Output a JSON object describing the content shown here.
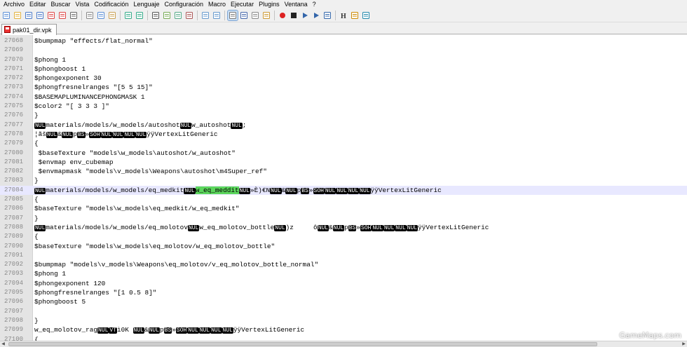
{
  "menu": [
    "Archivo",
    "Editar",
    "Buscar",
    "Vista",
    "Codificación",
    "Lenguaje",
    "Configuración",
    "Macro",
    "Ejecutar",
    "Plugins",
    "Ventana",
    "?"
  ],
  "toolbar_icons": [
    "new-file-icon",
    "open-file-icon",
    "save-icon",
    "save-all-icon",
    "close-icon",
    "close-all-icon",
    "print-icon",
    "cut-icon",
    "copy-icon",
    "paste-icon",
    "undo-icon",
    "redo-icon",
    "find-icon",
    "replace-icon",
    "zoom-in-icon",
    "zoom-out-icon",
    "sync-vertical-icon",
    "sync-horizontal-icon",
    "word-wrap-icon",
    "show-all-chars-icon",
    "indent-guide-icon",
    "doc-map-icon",
    "record-macro-icon",
    "stop-record-icon",
    "play-macro-icon",
    "run-macro-multiple-icon",
    "save-macro-icon",
    "function-list-icon",
    "spell-check-icon",
    "plugin-icon"
  ],
  "tab": {
    "label": "pak01_dir.vpk"
  },
  "lines": [
    {
      "n": "27068",
      "segs": [
        [
          "t",
          "$bumpmap \"effects/flat_normal\""
        ]
      ]
    },
    {
      "n": "27069",
      "segs": []
    },
    {
      "n": "27070",
      "segs": [
        [
          "t",
          "$phong 1"
        ]
      ]
    },
    {
      "n": "27071",
      "segs": [
        [
          "t",
          "$phongboost 1"
        ]
      ]
    },
    {
      "n": "27072",
      "segs": [
        [
          "t",
          "$phongexponent 30"
        ]
      ]
    },
    {
      "n": "27073",
      "segs": [
        [
          "t",
          "$phongfresnelranges \"[5 5 15]\""
        ]
      ]
    },
    {
      "n": "27074",
      "segs": [
        [
          "t",
          "$BASEMAPLUMINANCEPHONGMASK 1"
        ]
      ]
    },
    {
      "n": "27075",
      "segs": [
        [
          "t",
          "$color2 \"[ 3 3 3 ]\""
        ]
      ]
    },
    {
      "n": "27076",
      "segs": [
        [
          "t",
          "}"
        ]
      ]
    },
    {
      "n": "27077",
      "segs": [
        [
          "c",
          "NUL"
        ],
        [
          "t",
          "materials/models/w_models/autoshot"
        ],
        [
          "c",
          "NUL"
        ],
        [
          "t",
          "w_autoshot"
        ],
        [
          "c",
          "NUL"
        ],
        [
          "t",
          ";"
        ]
      ]
    },
    {
      "n": "27078",
      "segs": [
        [
          "t",
          "¦ãš"
        ],
        [
          "c",
          "NUL"
        ],
        [
          "t",
          "&"
        ],
        [
          "c",
          "NUL"
        ],
        [
          "t",
          "p"
        ],
        [
          "c",
          "BS"
        ],
        [
          "t",
          "»"
        ],
        [
          "c",
          "SOH"
        ],
        [
          "c",
          "NUL"
        ],
        [
          "c",
          "NUL"
        ],
        [
          "c",
          "NUL"
        ],
        [
          "c",
          "NUL"
        ],
        [
          "t",
          "ÿÿVertexLitGeneric"
        ]
      ]
    },
    {
      "n": "27079",
      "segs": [
        [
          "t",
          "{"
        ]
      ]
    },
    {
      "n": "27080",
      "segs": [
        [
          "t",
          " $baseTexture \"models\\w_models\\autoshot/w_autoshot\""
        ]
      ]
    },
    {
      "n": "27081",
      "segs": [
        [
          "t",
          " $envmap env_cubemap"
        ]
      ]
    },
    {
      "n": "27082",
      "segs": [
        [
          "t",
          " $envmapmask \"models\\v_models\\Weapons\\autoshot\\m4Super_ref\""
        ]
      ]
    },
    {
      "n": "27083",
      "segs": [
        [
          "t",
          "}"
        ]
      ]
    },
    {
      "n": "27084",
      "cur": true,
      "segs": [
        [
          "c",
          "NUL"
        ],
        [
          "t",
          "materials/models/w_models/eq_medkit"
        ],
        [
          "c",
          "NUL"
        ],
        [
          "s",
          "w_eq_meddit"
        ],
        [
          "c",
          "NUL"
        ],
        [
          "t",
          "»È)€N"
        ],
        [
          "c",
          "NUL"
        ],
        [
          "t",
          "&"
        ],
        [
          "c",
          "NUL"
        ],
        [
          "t",
          "p"
        ],
        [
          "c",
          "BS"
        ],
        [
          "t",
          "»"
        ],
        [
          "c",
          "SOH"
        ],
        [
          "c",
          "NUL"
        ],
        [
          "c",
          "NUL"
        ],
        [
          "c",
          "NUL"
        ],
        [
          "c",
          "NUL"
        ],
        [
          "t",
          "ÿÿVertexLitGeneric"
        ]
      ]
    },
    {
      "n": "27085",
      "segs": [
        [
          "t",
          "{"
        ]
      ]
    },
    {
      "n": "27086",
      "segs": [
        [
          "t",
          "$baseTexture \"models\\w_models\\eq_medkit/w_eq_medkit\""
        ]
      ]
    },
    {
      "n": "27087",
      "segs": [
        [
          "t",
          "}"
        ]
      ]
    },
    {
      "n": "27088",
      "segs": [
        [
          "c",
          "NUL"
        ],
        [
          "t",
          "materials/models/w_models/eq_molotov"
        ],
        [
          "c",
          "NUL"
        ],
        [
          "t",
          "w_eq_molotov_bottle"
        ],
        [
          "c",
          "NUL"
        ],
        [
          "t",
          ")z     ô"
        ],
        [
          "c",
          "NUL"
        ],
        [
          "t",
          "&"
        ],
        [
          "c",
          "NUL"
        ],
        [
          "t",
          "p"
        ],
        [
          "c",
          "BS"
        ],
        [
          "t",
          "»"
        ],
        [
          "c",
          "SOH"
        ],
        [
          "c",
          "NUL"
        ],
        [
          "c",
          "NUL"
        ],
        [
          "c",
          "NUL"
        ],
        [
          "c",
          "NUL"
        ],
        [
          "t",
          "ÿÿVertexLitGeneric"
        ]
      ]
    },
    {
      "n": "27089",
      "segs": [
        [
          "t",
          "{"
        ]
      ]
    },
    {
      "n": "27090",
      "segs": [
        [
          "t",
          "$baseTexture \"models\\w_models\\eq_molotov/w_eq_molotov_bottle\""
        ]
      ]
    },
    {
      "n": "27091",
      "segs": []
    },
    {
      "n": "27092",
      "segs": [
        [
          "t",
          "$bumpmap \"models\\v_models\\Weapons\\eq_molotov/v_eq_molotov_bottle_normal\""
        ]
      ]
    },
    {
      "n": "27093",
      "segs": [
        [
          "t",
          "$phong 1"
        ]
      ]
    },
    {
      "n": "27094",
      "segs": [
        [
          "t",
          "$phongexponent 120"
        ]
      ]
    },
    {
      "n": "27095",
      "segs": [
        [
          "t",
          "$phongfresnelranges \"[1 0.5 8]\""
        ]
      ]
    },
    {
      "n": "27096",
      "segs": [
        [
          "t",
          "$phongboost 5"
        ]
      ]
    },
    {
      "n": "27097",
      "segs": []
    },
    {
      "n": "27098",
      "segs": [
        [
          "t",
          "}"
        ]
      ]
    },
    {
      "n": "27099",
      "segs": [
        [
          "t",
          "w_eq_molotov_rag"
        ],
        [
          "c",
          "NUL"
        ],
        [
          "c",
          "VT"
        ],
        [
          "t",
          "ì0K "
        ],
        [
          "c",
          "NUL"
        ],
        [
          "t",
          "&"
        ],
        [
          "c",
          "NUL"
        ],
        [
          "t",
          "p"
        ],
        [
          "c",
          "BS"
        ],
        [
          "t",
          "»"
        ],
        [
          "c",
          "SOH"
        ],
        [
          "c",
          "NUL"
        ],
        [
          "c",
          "NUL"
        ],
        [
          "c",
          "NUL"
        ],
        [
          "c",
          "NUL"
        ],
        [
          "t",
          "ÿÿVertexLitGeneric"
        ]
      ]
    },
    {
      "n": "27100",
      "segs": [
        [
          "t",
          "{"
        ]
      ]
    }
  ],
  "watermark": "GameMaps.com"
}
